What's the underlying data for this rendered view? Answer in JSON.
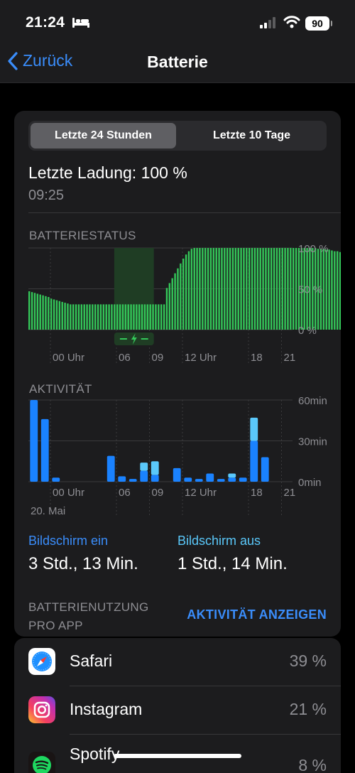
{
  "status_bar": {
    "time": "21:24",
    "battery_level": "90"
  },
  "nav": {
    "back_label": "Zurück",
    "title": "Batterie"
  },
  "segments": {
    "selected": "Letzte 24 Stunden",
    "other": "Letzte 10 Tage"
  },
  "last_charge": {
    "label": "Letzte Ladung: 100 %",
    "time": "09:25"
  },
  "colors": {
    "battery_green": "#34c759",
    "screen_on_blue": "#1a82ff",
    "screen_off_blue": "#5ac8fa",
    "link_blue": "#3a8dfb"
  },
  "battery_chart": {
    "title": "BATTERIESTATUS",
    "y_ticks": [
      "100 %",
      "50 %",
      "0 %"
    ],
    "x_ticks": [
      "00 Uhr",
      "06",
      "09",
      "12 Uhr",
      "18",
      "21"
    ]
  },
  "activity_chart": {
    "title": "AKTIVITÄT",
    "y_ticks": [
      "60min",
      "30min",
      "0min"
    ],
    "x_ticks": [
      "00 Uhr",
      "06",
      "09",
      "12 Uhr",
      "18",
      "21"
    ],
    "date_label": "20. Mai"
  },
  "chart_data": [
    {
      "type": "bar",
      "title": "BATTERIESTATUS",
      "unit": "%",
      "ylim": [
        0,
        100
      ],
      "x_start_hour": 22.0,
      "x_step_hours": 0.25,
      "charging_interval": [
        5.8,
        9.4
      ],
      "values": [
        47,
        46,
        45,
        44,
        43,
        42,
        41,
        40,
        38,
        37,
        36,
        35,
        34,
        33,
        32,
        31,
        31,
        31,
        31,
        31,
        31,
        31,
        31,
        31,
        31,
        31,
        31,
        31,
        31,
        31,
        31,
        31,
        31,
        31,
        31,
        31,
        31,
        31,
        31,
        31,
        31,
        31,
        31,
        31,
        31,
        31,
        31,
        31,
        31,
        31,
        51,
        57,
        63,
        69,
        75,
        81,
        87,
        92,
        96,
        99,
        100,
        100,
        100,
        100,
        100,
        100,
        100,
        100,
        100,
        100,
        100,
        100,
        100,
        100,
        100,
        100,
        100,
        100,
        100,
        100,
        100,
        100,
        100,
        100,
        100,
        100,
        100,
        100,
        100,
        100,
        100,
        100,
        100,
        100,
        100,
        100,
        100,
        100,
        100,
        100,
        100,
        100,
        100,
        100,
        100,
        99,
        99,
        99,
        98,
        98,
        97,
        96,
        96,
        95,
        95,
        94,
        93,
        93,
        92,
        92,
        91,
        90,
        90,
        90
      ]
    },
    {
      "type": "bar",
      "title": "AKTIVITÄT",
      "unit": "min",
      "ylim": [
        0,
        60
      ],
      "series": [
        {
          "name": "Bildschirm ein",
          "x_hour": [
            22.5,
            23.5,
            0.5,
            5.5,
            6.5,
            7.5,
            8.5,
            9.5,
            11.5,
            12.5,
            13.5,
            14.5,
            15.5,
            16.5,
            17.5,
            18.5,
            19.5
          ],
          "values": [
            60,
            46,
            3,
            19,
            4,
            2,
            8,
            5,
            10,
            3,
            2,
            6,
            2,
            3,
            3,
            30,
            18
          ]
        },
        {
          "name": "Bildschirm aus",
          "x_hour": [
            22.5,
            23.5,
            0.5,
            5.5,
            6.5,
            7.5,
            8.5,
            9.5,
            11.5,
            12.5,
            13.5,
            14.5,
            15.5,
            16.5,
            17.5,
            18.5,
            19.5
          ],
          "values": [
            0,
            0,
            0,
            0,
            0,
            0,
            6,
            10,
            0,
            0,
            0,
            0,
            0,
            3,
            0,
            17,
            0
          ]
        }
      ]
    }
  ],
  "screen_usage": {
    "on_label": "Bildschirm ein",
    "on_value": "3 Std., 13 Min.",
    "off_label": "Bildschirm aus",
    "off_value": "1 Std., 14 Min."
  },
  "app_usage": {
    "header_line1": "BATTERIENUTZUNG",
    "header_line2": "PRO APP",
    "link": "AKTIVITÄT ANZEIGEN",
    "apps": [
      {
        "name": "Safari",
        "pct": "39 %",
        "icon": "safari-icon"
      },
      {
        "name": "Instagram",
        "pct": "21 %",
        "icon": "instagram-icon"
      },
      {
        "name": "Spotify",
        "pct": "8 %",
        "icon": "spotify-icon"
      }
    ]
  }
}
